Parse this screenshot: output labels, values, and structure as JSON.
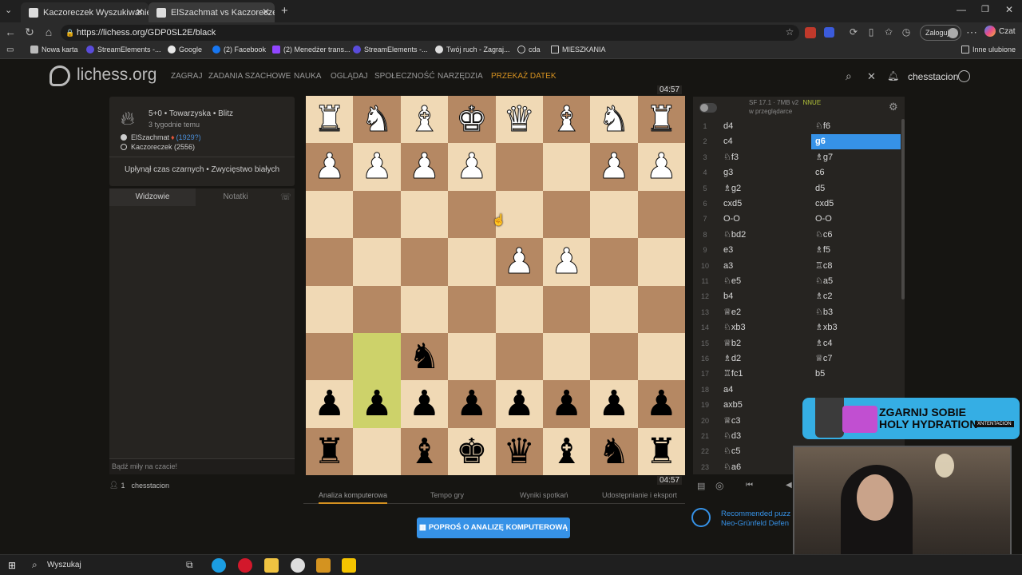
{
  "browser": {
    "tabs": [
      {
        "label": "Kaczoreczek Wyszukiwanie zaawan",
        "active": false
      },
      {
        "label": "ElSzachmat vs Kaczoreczek: N",
        "active": true
      }
    ],
    "url": "https://lichess.org/GDP0SL2E/black",
    "login_label": "Zaloguj",
    "chat_label": "Czat",
    "bookmarks": [
      "Nowa karta",
      "StreamElements -...",
      "Google",
      "(2) Facebook",
      "(2) Menedżer trans...",
      "StreamElements -...",
      "Twój ruch - Zagraj...",
      "cda",
      "MIESZKANIA"
    ],
    "other_bookmarks": "Inne ulubione"
  },
  "site": {
    "logo": "lichess.org",
    "nav": [
      "ZAGRAJ",
      "ZADANIA SZACHOWE",
      "NAUKA",
      "OGLĄDAJ",
      "SPOŁECZNOŚĆ",
      "NARZĘDZIA",
      "PRZEKAŻ DATEK"
    ],
    "username": "chesstacion"
  },
  "game": {
    "type": "5+0 • Towarzyska • Blitz",
    "when": "3 tygodnie temu",
    "white_player": "ElSzachmat",
    "white_rating": "(1929?)",
    "black_player": "Kaczoreczek (2556)",
    "result": "Upłynął czas czarnych • Zwycięstwo białych",
    "clock_top": "04:57",
    "clock_bottom": "04:57"
  },
  "chat": {
    "tab_spectators": "Widzowie",
    "tab_notes": "Notatki",
    "placeholder": "Bądź miły na czacie!",
    "viewers_count": "1",
    "viewer": "chesstacion"
  },
  "engine": {
    "name": "SF 17.1 · 7MB v2",
    "nnue": "NNUE",
    "location": "w przeglądarce"
  },
  "moves": [
    {
      "n": "1",
      "w": "d4",
      "b": "♘f6"
    },
    {
      "n": "2",
      "w": "c4",
      "b": "g6"
    },
    {
      "n": "3",
      "w": "♘f3",
      "b": "♗g7"
    },
    {
      "n": "4",
      "w": "g3",
      "b": "c6"
    },
    {
      "n": "5",
      "w": "♗g2",
      "b": "d5"
    },
    {
      "n": "6",
      "w": "cxd5",
      "b": "cxd5"
    },
    {
      "n": "7",
      "w": "O-O",
      "b": "O-O"
    },
    {
      "n": "8",
      "w": "♘bd2",
      "b": "♘c6"
    },
    {
      "n": "9",
      "w": "e3",
      "b": "♗f5"
    },
    {
      "n": "10",
      "w": "a3",
      "b": "♖c8"
    },
    {
      "n": "11",
      "w": "♘e5",
      "b": "♘a5"
    },
    {
      "n": "12",
      "w": "b4",
      "b": "♗c2"
    },
    {
      "n": "13",
      "w": "♕e2",
      "b": "♘b3"
    },
    {
      "n": "14",
      "w": "♘xb3",
      "b": "♗xb3"
    },
    {
      "n": "15",
      "w": "♕b2",
      "b": "♗c4"
    },
    {
      "n": "16",
      "w": "♗d2",
      "b": "♕c7"
    },
    {
      "n": "17",
      "w": "♖fc1",
      "b": "b5"
    },
    {
      "n": "18",
      "w": "a4",
      "b": ""
    },
    {
      "n": "19",
      "w": "axb5",
      "b": ""
    },
    {
      "n": "20",
      "w": "♕c3",
      "b": ""
    },
    {
      "n": "21",
      "w": "♘d3",
      "b": ""
    },
    {
      "n": "22",
      "w": "♘c5",
      "b": ""
    },
    {
      "n": "23",
      "w": "♘a6",
      "b": ""
    }
  ],
  "active_move_index": 1,
  "under_board_tabs": [
    "Analiza komputerowa",
    "Tempo gry",
    "Wyniki spotkań",
    "Udostępnianie i eksport"
  ],
  "analysis_button": "POPROŚ O ANALIZĘ KOMPUTEROWĄ",
  "puzzle": {
    "line1": "Recommended puzz",
    "line2": "Neo-Grünfeld Defen"
  },
  "ad": {
    "line1": "ZGARNIJ SOBIE",
    "line2": "HOLY HYDRATION",
    "tag": "XNTENTACION"
  },
  "taskbar": {
    "search": "Wyszukaj"
  },
  "board": {
    "light": "#f0d9b5",
    "dark": "#b58863",
    "highlight": "#cdd26a",
    "rows": [
      [
        "wR",
        "wN",
        "wB",
        "wK",
        "wQ",
        "wB",
        "wN",
        "wR"
      ],
      [
        "wP",
        "wP",
        "wP",
        "wP",
        "",
        "",
        "wP",
        "wP"
      ],
      [
        "",
        "",
        "",
        "",
        "",
        "",
        "",
        ""
      ],
      [
        "",
        "",
        "",
        "",
        "wP",
        "wP",
        "",
        ""
      ],
      [
        "",
        "",
        "",
        "",
        "",
        "",
        "",
        ""
      ],
      [
        "",
        "",
        "bN",
        "",
        "",
        "",
        "",
        ""
      ],
      [
        "bP",
        "bP",
        "bP",
        "bP",
        "bP",
        "bP",
        "bP",
        "bP"
      ],
      [
        "bR",
        "",
        "bB",
        "bK",
        "bQ",
        "bB",
        "bN",
        "bR"
      ]
    ],
    "highlighted": [
      [
        5,
        1
      ],
      [
        6,
        1
      ]
    ]
  }
}
